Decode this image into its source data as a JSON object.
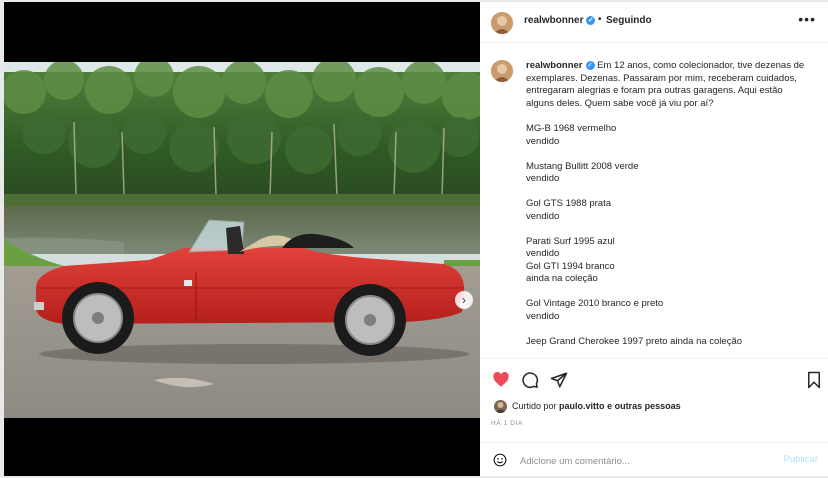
{
  "post": {
    "author": "realwbonner",
    "follow_status": "Seguindo",
    "separator": "•",
    "more_label": "•••",
    "verified_mark": "✓"
  },
  "caption": {
    "intro": "Em 12 anos, como colecionador, tive dezenas de exemplares. Dezenas. Passaram por mim, receberam cuidados, entregaram alegrias e foram pra outras garagens. Aqui estão alguns deles. Quem sabe você já viu por aí?",
    "lines": [
      "MG-B 1968 vermelho",
      "vendido",
      "",
      "Mustang Bullitt 2008 verde",
      "vendido",
      "",
      "Gol GTS 1988 prata",
      "vendido",
      "",
      "Parati Surf 1995 azul",
      "vendido",
      "Gol GTI 1994 branco",
      "ainda na coleção",
      "",
      "Gol Vintage 2010 branco e preto",
      "vendido",
      "",
      "Jeep Grand Cherokee 1997 preto ainda na coleção"
    ]
  },
  "likes": {
    "prefix": "Curtido por",
    "user": "paulo.vitto",
    "suffix": "e outras pessoas"
  },
  "timestamp": "HÁ 1 DIA",
  "comment": {
    "placeholder": "Adicione um comentário...",
    "post_label": "Publicar"
  },
  "media": {
    "next_arrow": "›"
  },
  "colors": {
    "like_red": "#ed4956",
    "verified_blue": "#3897f0",
    "publish_disabled": "#b2dffc",
    "car_red": "#d42a2a"
  }
}
